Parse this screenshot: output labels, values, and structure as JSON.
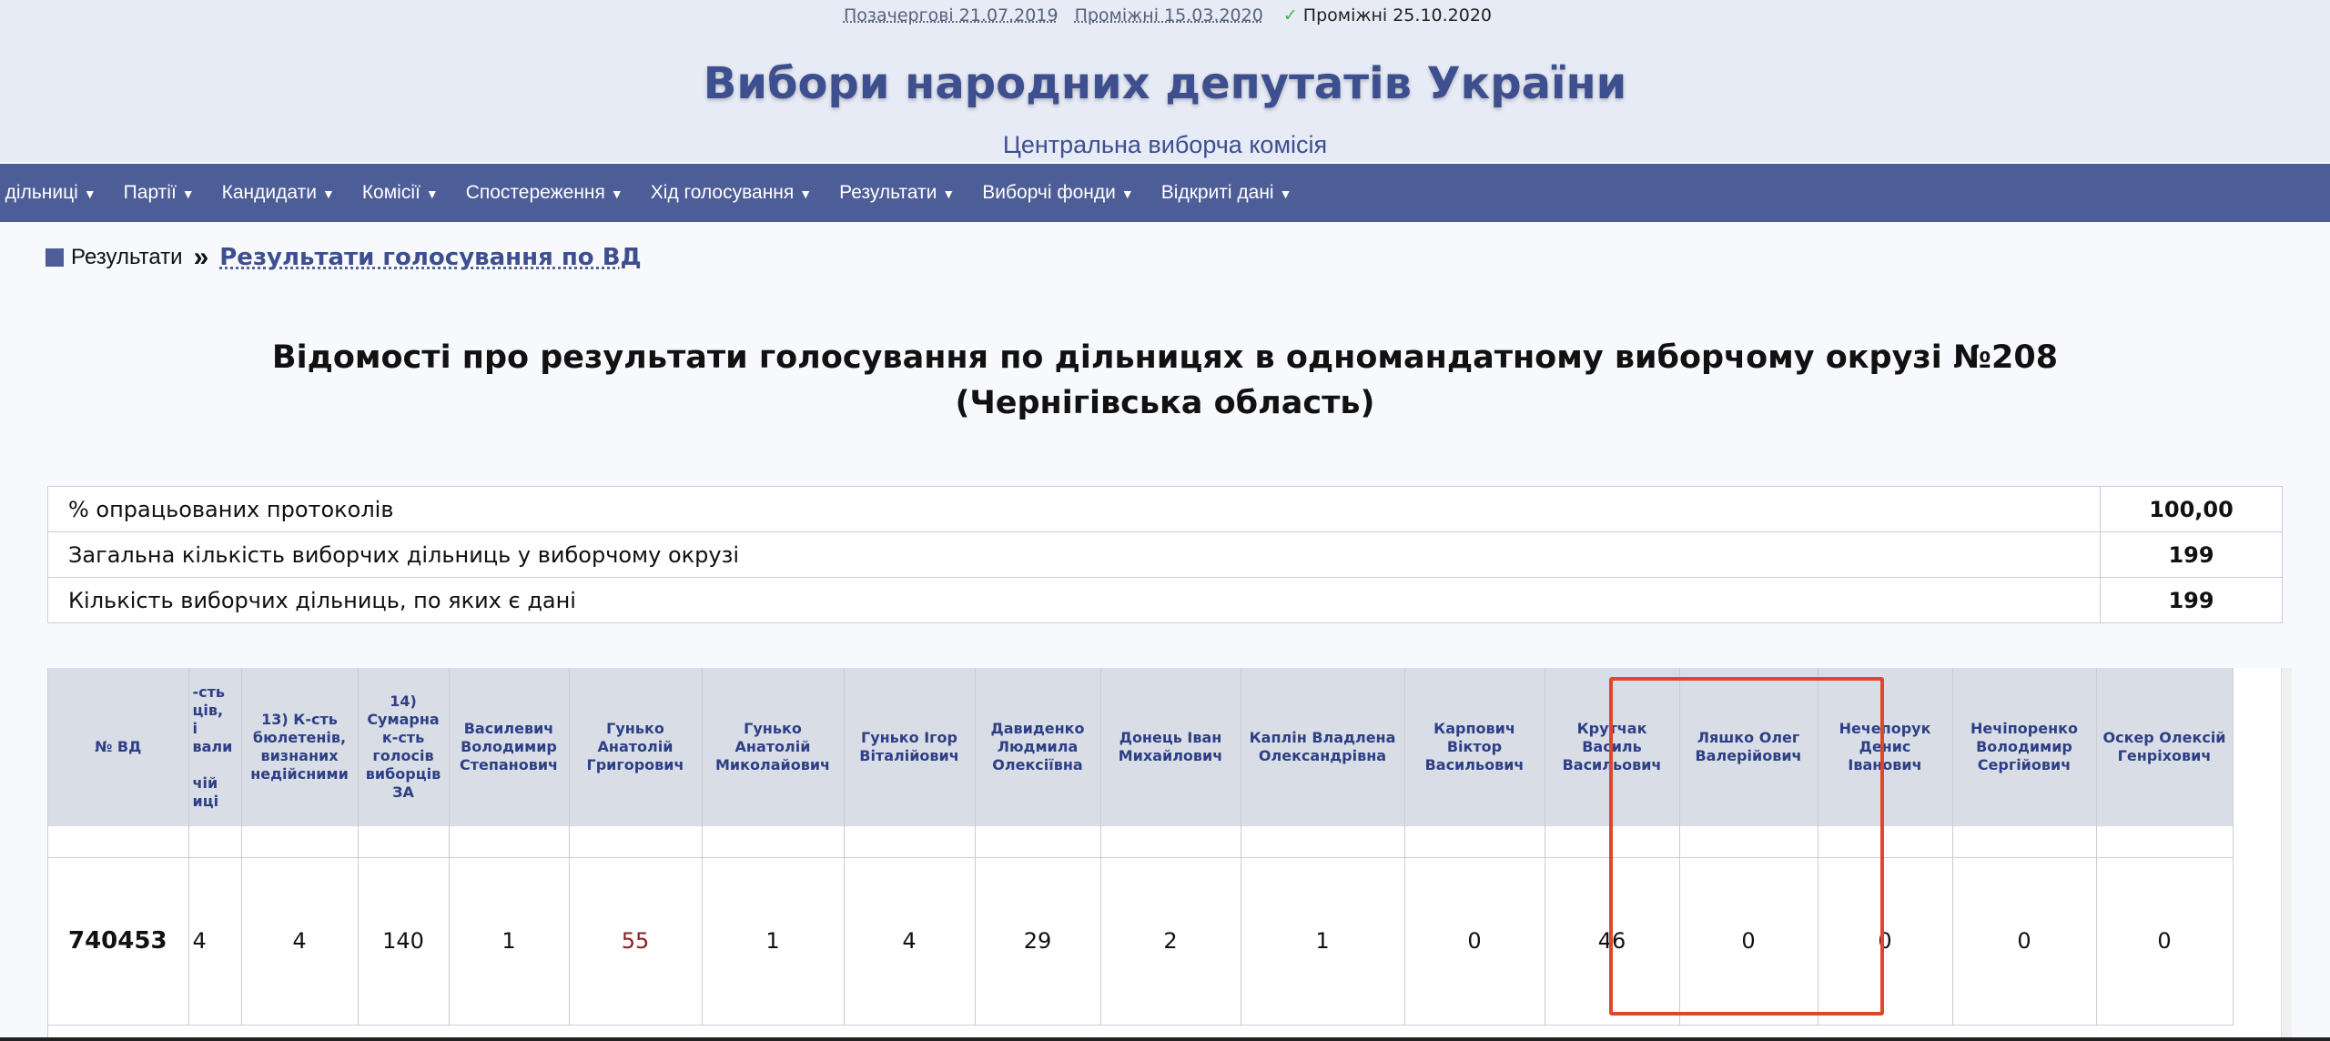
{
  "elections_nav": {
    "links": [
      "Позачергові 21.07.2019",
      "Проміжні 15.03.2020"
    ],
    "current": "Проміжні 25.10.2020"
  },
  "site": {
    "title": "Вибори народних депутатів України",
    "subtitle": "Центральна виборча комісія"
  },
  "menu": [
    ", дільниці",
    "Партії",
    "Кандидати",
    "Комісії",
    "Спостереження",
    "Хід голосування",
    "Результати",
    "Виборчі фонди",
    "Відкриті дані"
  ],
  "breadcrumb": {
    "parent": "Результати",
    "separator": "»",
    "current": "Результати голосування по ВД"
  },
  "page_title": {
    "line1": "Відомості про результати голосування по дільницях в одномандатному виборчому окрузі №208",
    "line2": "(Чернігівська область)"
  },
  "summary": [
    {
      "label": "% опрацьованих протоколів",
      "value": "100,00"
    },
    {
      "label": "Загальна кількість виборчих дільниць у виборчому окрузі",
      "value": "199"
    },
    {
      "label": "Кількість виборчих дільниць, по яких є дані",
      "value": "199"
    }
  ],
  "results": {
    "headers": {
      "precinct": "№ ВД",
      "truncated": "-сть\nців,\nі\nвали\n\nчій\nиці",
      "invalid": "13) К-сть бюлетенів, визнаних недійсними",
      "total_for": "14) Сумарна к-сть голосів виборців ЗА",
      "candidates": [
        "Василевич Володимир Степанович",
        "Гунько Анатолій Григорович",
        "Гунько Анатолій Миколайович",
        "Гунько Ігор Віталійович",
        "Давиденко Людмила Олексіївна",
        "Донець Іван Михайлович",
        "Каплін Владлена Олександрівна",
        "Карпович Віктор Васильович",
        "Крутчак Василь Васильович",
        "Ляшко Олег Валерійович",
        "Нечепорук Денис Іванович",
        "Нечіпоренко Володимир Сергійович",
        "Оскер Олексій Генріхович"
      ]
    },
    "row": {
      "precinct": "740453",
      "truncated": "4",
      "invalid": "4",
      "total_for": "140",
      "candidate_votes": [
        "1",
        "55",
        "1",
        "4",
        "29",
        "2",
        "1",
        "0",
        "46",
        "0",
        "0",
        "0",
        "0"
      ]
    }
  },
  "colors": {
    "header_bg": "#e7ebf6",
    "menu_bg": "#4d5d98",
    "title_color": "#3d4f8f",
    "winner": "#8c2020",
    "highlight": "#e0462a"
  }
}
